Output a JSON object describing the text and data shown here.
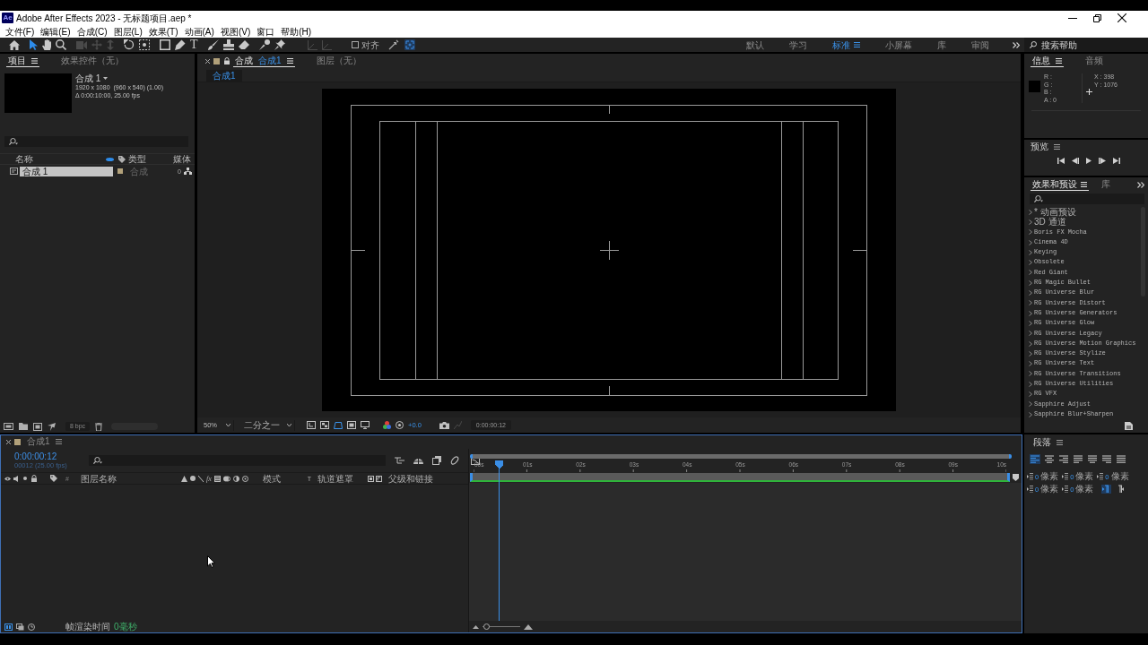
{
  "window": {
    "logo": "Ae",
    "title": "Adobe After Effects 2023 - 无标题项目.aep *"
  },
  "menu": [
    "文件(F)",
    "编辑(E)",
    "合成(C)",
    "图层(L)",
    "效果(T)",
    "动画(A)",
    "视图(V)",
    "窗口",
    "帮助(H)"
  ],
  "toolbar": {
    "tools": [
      {
        "kind": "home",
        "selected": false,
        "disabled": false
      },
      {
        "kind": "pointer",
        "selected": true,
        "disabled": false
      },
      {
        "kind": "hand",
        "selected": false,
        "disabled": false
      },
      {
        "kind": "magnifier",
        "selected": false,
        "disabled": false
      },
      {
        "kind": "camera",
        "selected": false,
        "disabled": true
      },
      {
        "kind": "move",
        "selected": false,
        "disabled": true
      },
      {
        "kind": "dolly",
        "selected": false,
        "disabled": true
      },
      {
        "kind": "rotate",
        "selected": false,
        "disabled": false
      },
      {
        "kind": "anchor",
        "selected": false,
        "disabled": false
      },
      {
        "kind": "rectangle",
        "selected": false,
        "disabled": false
      },
      {
        "kind": "pen",
        "selected": false,
        "disabled": false
      },
      {
        "kind": "type",
        "glyph": "T",
        "selected": false,
        "disabled": false
      },
      {
        "kind": "brush",
        "selected": false,
        "disabled": false
      },
      {
        "kind": "stamp",
        "selected": false,
        "disabled": false
      },
      {
        "kind": "eraser",
        "selected": false,
        "disabled": false
      },
      {
        "kind": "roto",
        "selected": false,
        "disabled": false
      },
      {
        "kind": "pin",
        "selected": false,
        "disabled": false
      },
      {
        "kind": "axis",
        "selected": false,
        "disabled": true
      },
      {
        "kind": "axis",
        "selected": false,
        "disabled": true
      }
    ],
    "snap": {
      "label": "对齐",
      "checked": false
    },
    "snap_options": [
      {
        "selected": false
      },
      {
        "selected": true
      }
    ],
    "workspaces": [
      {
        "label": "默认",
        "selected": false
      },
      {
        "label": "学习",
        "selected": false
      },
      {
        "label": "标准",
        "selected": true
      },
      {
        "label": "小屏幕",
        "selected": false
      },
      {
        "label": "库",
        "selected": false
      },
      {
        "label": "审阅",
        "selected": false
      }
    ],
    "help_search": {
      "placeholder": "搜索帮助"
    }
  },
  "project_panel": {
    "tabs": [
      {
        "label": "项目",
        "selected": true
      },
      {
        "label": "效果控件（无）",
        "selected": false
      }
    ],
    "preview": {
      "name": "合成 1",
      "details": [
        "1920 x 1080  (960 x 540) (1.00)",
        "Δ 0:00:10:00, 25.00 fps"
      ]
    },
    "columns": [
      "名称",
      "类型",
      "媒体"
    ],
    "items": [
      {
        "name": "合成 1",
        "type": "合成",
        "media": "0",
        "selected": true
      }
    ],
    "bit_depth": "8 bpc"
  },
  "composition_panel": {
    "tabs": [
      {
        "label": "合成",
        "comp": "合成1",
        "selected": true
      },
      {
        "label": "图层（无）",
        "selected": false
      }
    ],
    "breadcrumb": "合成1",
    "zoom": "50%",
    "resolution": "二分之一",
    "exposure": "+0.0",
    "timecode": "0:00:00:12"
  },
  "info_panel": {
    "tabs": [
      {
        "label": "信息",
        "selected": true
      },
      {
        "label": "音频",
        "selected": false
      }
    ],
    "color_readout": [
      "R :",
      "G :",
      "B :",
      "A : 0"
    ],
    "position_readout": [
      "X : 398",
      "Y : 1076"
    ]
  },
  "preview_panel": {
    "title": "预览"
  },
  "effects_panel": {
    "tabs": [
      {
        "label": "效果和预设",
        "selected": true
      },
      {
        "label": "库",
        "selected": false
      }
    ],
    "items": [
      {
        "label": "* 动画预设",
        "expanded": false
      },
      {
        "label": "3D 通道",
        "expanded": false
      },
      {
        "label": "Boris FX Mocha",
        "expanded": false
      },
      {
        "label": "Cinema 4D",
        "expanded": false
      },
      {
        "label": "Keying",
        "expanded": false
      },
      {
        "label": "Obsolete",
        "expanded": false
      },
      {
        "label": "Red Giant",
        "expanded": false
      },
      {
        "label": "RG Magic Bullet",
        "expanded": false
      },
      {
        "label": "RG Universe Blur",
        "expanded": false
      },
      {
        "label": "RG Universe Distort",
        "expanded": false
      },
      {
        "label": "RG Universe Generators",
        "expanded": false
      },
      {
        "label": "RG Universe Glow",
        "expanded": false
      },
      {
        "label": "RG Universe Legacy",
        "expanded": false
      },
      {
        "label": "RG Universe Motion Graphics",
        "expanded": false
      },
      {
        "label": "RG Universe Stylize",
        "expanded": false
      },
      {
        "label": "RG Universe Text",
        "expanded": false
      },
      {
        "label": "RG Universe Transitions",
        "expanded": false
      },
      {
        "label": "RG Universe Utilities",
        "expanded": false
      },
      {
        "label": "RG VFX",
        "expanded": false
      },
      {
        "label": "Sapphire Adjust",
        "expanded": false
      },
      {
        "label": "Sapphire Blur+Sharpen",
        "expanded": false
      }
    ]
  },
  "timeline": {
    "tab": "合成1",
    "timecode": "0:00:00:12",
    "frame_info": "00012 (25.00 fps)",
    "columns": [
      "#",
      "图层名称",
      "模式",
      "T",
      "轨道遮罩",
      "父级和链接"
    ],
    "fx_label": "fx",
    "ruler": [
      "00s",
      "01s",
      "02s",
      "03s",
      "04s",
      "05s",
      "06s",
      "07s",
      "08s",
      "09s",
      "10s"
    ],
    "playhead": {
      "level": 0.048
    },
    "zoom_slider": {
      "level": 0.1
    }
  },
  "status_bar": {
    "label": "帧渲染时间",
    "value": "0毫秒"
  },
  "paragraph_panel": {
    "title": "段落",
    "alignments": [
      {
        "selected": true
      },
      {
        "selected": false
      },
      {
        "selected": false
      },
      {
        "selected": false
      },
      {
        "selected": false
      },
      {
        "selected": false
      },
      {
        "selected": false
      }
    ],
    "fields": [
      {
        "value": "0",
        "unit": "像素"
      },
      {
        "value": "0",
        "unit": "像素"
      },
      {
        "value": "0",
        "unit": "像素"
      },
      {
        "value": "0",
        "unit": "像素"
      },
      {
        "value": "0",
        "unit": "像素"
      }
    ],
    "directions": [
      {
        "selected": true
      },
      {
        "selected": false
      }
    ]
  }
}
